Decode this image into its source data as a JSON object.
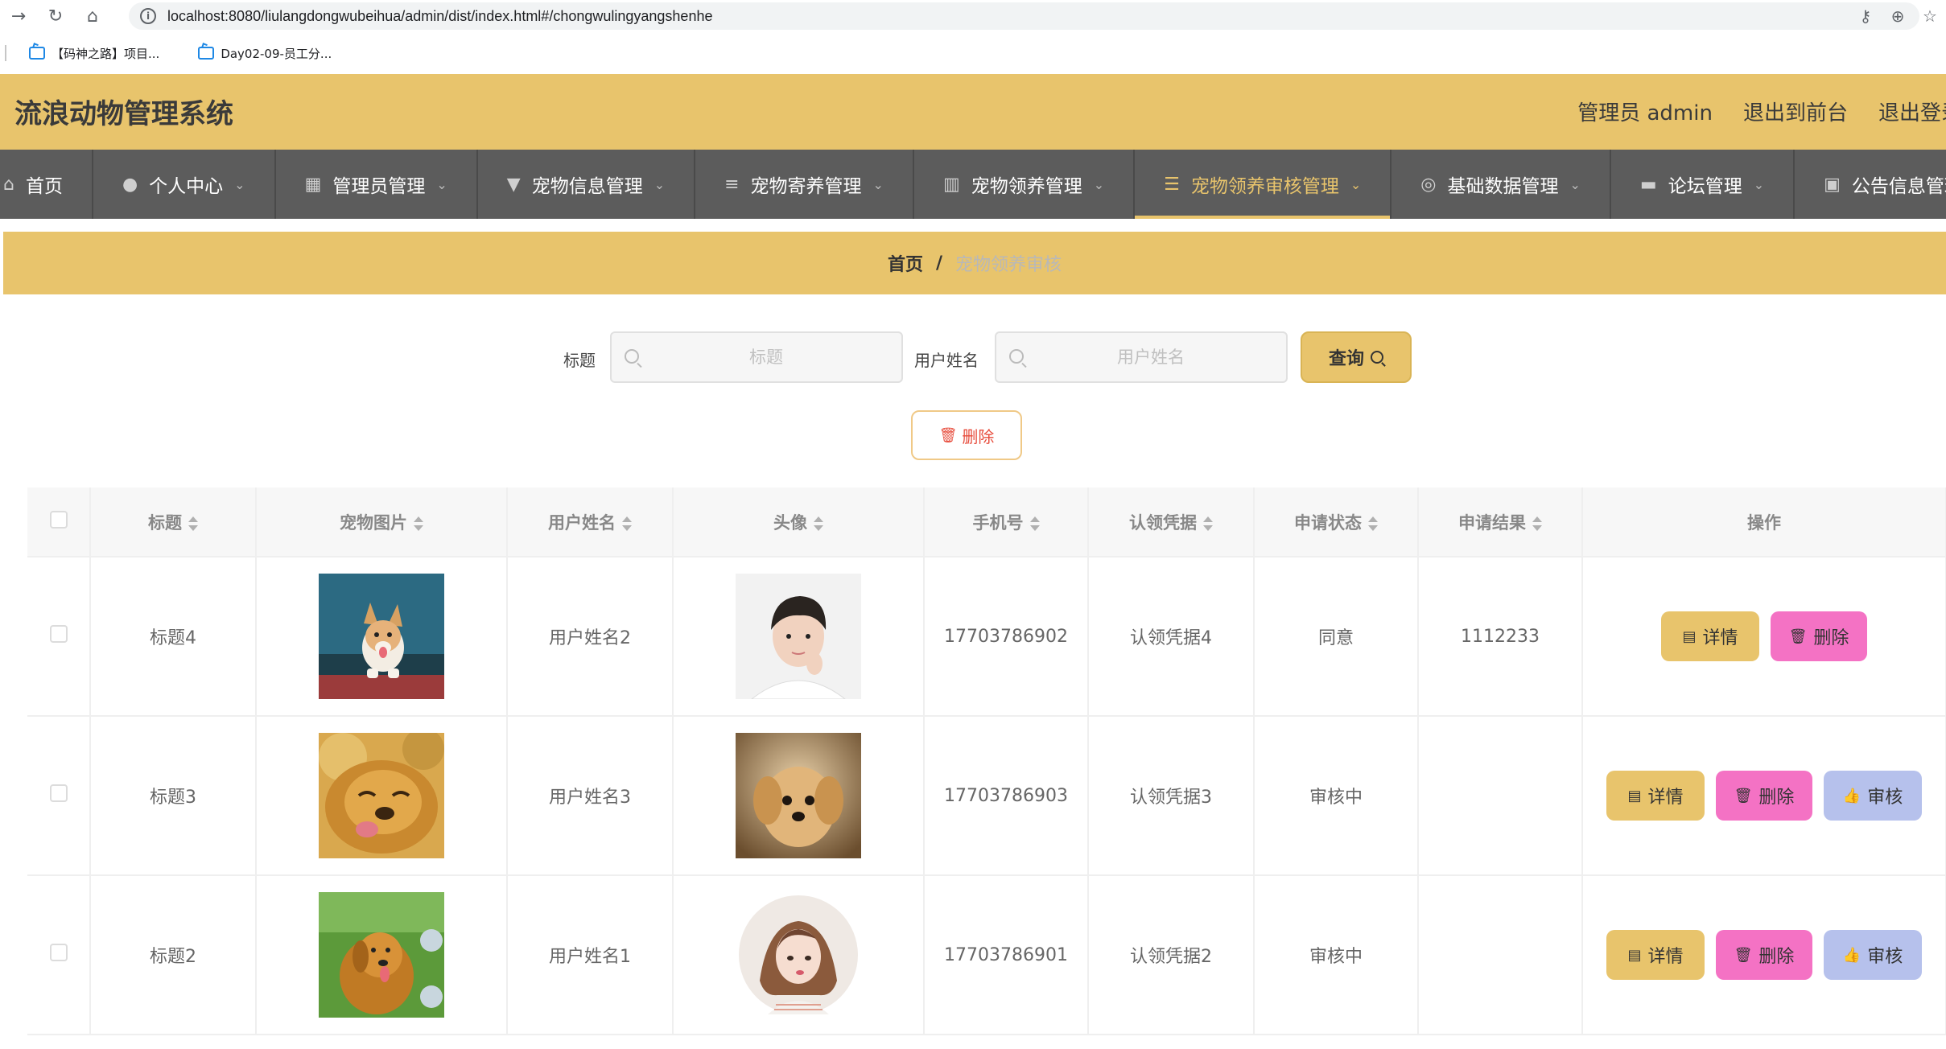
{
  "browser": {
    "url": "localhost:8080/liulangdongwubeihua/admin/dist/index.html#/chongwulingyangshenhe",
    "bookmarks": [
      {
        "label": "【码神之路】项目..."
      },
      {
        "label": "Day02-09-员工分..."
      }
    ]
  },
  "header": {
    "title": "流浪动物管理系统",
    "links": [
      "管理员 admin",
      "退出到前台",
      "退出登录"
    ]
  },
  "nav": {
    "items": [
      {
        "label": "首页",
        "icon": "home-icon",
        "glyph": "⌂"
      },
      {
        "label": "个人中心",
        "icon": "user-icon",
        "glyph": "●"
      },
      {
        "label": "管理员管理",
        "icon": "grid-icon",
        "glyph": "▦"
      },
      {
        "label": "宠物信息管理",
        "icon": "brush-icon",
        "glyph": "▼"
      },
      {
        "label": "宠物寄养管理",
        "icon": "sliders-icon",
        "glyph": "≡"
      },
      {
        "label": "宠物领养管理",
        "icon": "books-icon",
        "glyph": "▥"
      },
      {
        "label": "宠物领养审核管理",
        "icon": "list-icon",
        "glyph": "☰"
      },
      {
        "label": "基础数据管理",
        "icon": "microphone-icon",
        "glyph": "◎"
      },
      {
        "label": "论坛管理",
        "icon": "chat-icon",
        "glyph": "▬"
      },
      {
        "label": "公告信息管理",
        "icon": "clipboard-icon",
        "glyph": "▣"
      }
    ],
    "active_index": 6
  },
  "breadcrumb": {
    "home": "首页",
    "separator": "/",
    "current": "宠物领养审核"
  },
  "search": {
    "title_label": "标题",
    "title_placeholder": "标题",
    "username_label": "用户姓名",
    "username_placeholder": "用户姓名",
    "query_label": "查询"
  },
  "toolbar": {
    "delete_label": "删除"
  },
  "table": {
    "columns": [
      "标题",
      "宠物图片",
      "用户姓名",
      "头像",
      "手机号",
      "认领凭据",
      "申请状态",
      "申请结果",
      "操作"
    ],
    "rows": [
      {
        "title": "标题4",
        "pet_image": "corgi-photo",
        "username": "用户姓名2",
        "avatar": "young-man-photo",
        "phone": "17703786902",
        "proof": "认领凭据4",
        "status": "同意",
        "result": "1112233",
        "actions": [
          "详情",
          "删除"
        ]
      },
      {
        "title": "标题3",
        "pet_image": "golden-retriever-photo",
        "username": "用户姓名3",
        "avatar": "puppy-photo",
        "phone": "17703786903",
        "proof": "认领凭据3",
        "status": "审核中",
        "result": "",
        "actions": [
          "详情",
          "删除",
          "审核"
        ]
      },
      {
        "title": "标题2",
        "pet_image": "golden-retriever-grass-photo",
        "username": "用户姓名1",
        "avatar": "girl-illustration",
        "phone": "17703786901",
        "proof": "认领凭据2",
        "status": "审核中",
        "result": "",
        "actions": [
          "详情",
          "删除",
          "审核"
        ]
      }
    ]
  },
  "colors": {
    "accent": "#e8c46c",
    "nav_bg": "#5c5c5c",
    "delete_pink": "#f472c4",
    "audit_blue": "#b6c1ec"
  }
}
